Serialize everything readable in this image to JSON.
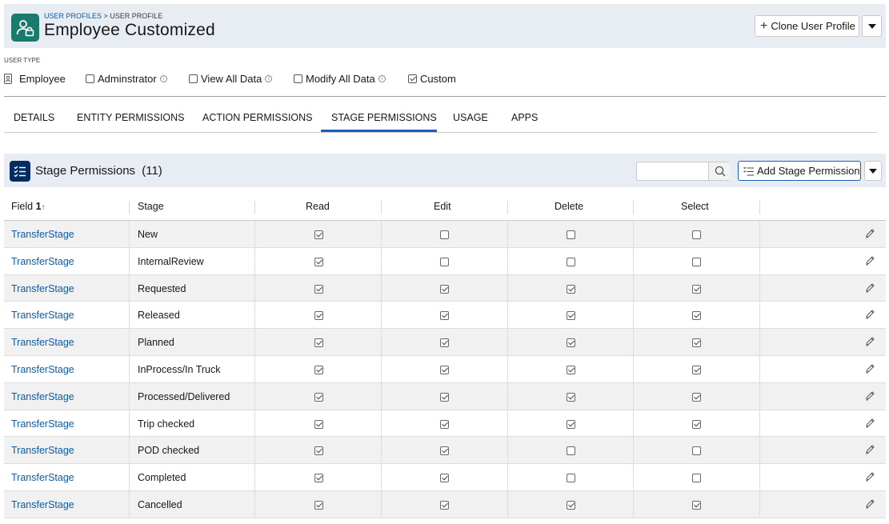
{
  "header": {
    "breadcrumb": {
      "parent": "USER PROFILES",
      "separator": " > ",
      "current": "USER PROFILE"
    },
    "title": "Employee Customized",
    "icon": "user-profile-icon",
    "actions": {
      "clone_label": "Clone User Profile",
      "more_icon": "chevron-down-icon"
    },
    "accent_color": "#1a7a6b"
  },
  "user_type": {
    "label": "USER TYPE",
    "options": [
      {
        "label": "Employee",
        "icon": "employee-badge-icon",
        "checked": null
      },
      {
        "label": "Adminstrator",
        "checked": false,
        "info": true
      },
      {
        "label": "View All Data",
        "checked": false,
        "info": true
      },
      {
        "label": "Modify All Data",
        "checked": false,
        "info": true
      },
      {
        "label": "Custom",
        "checked": true,
        "info": false
      }
    ]
  },
  "tabs": [
    {
      "label": "DETAILS",
      "active": false
    },
    {
      "label": "ENTITY PERMISSIONS",
      "active": false
    },
    {
      "label": "ACTION PERMISSIONS",
      "active": false
    },
    {
      "label": "STAGE PERMISSIONS",
      "active": true
    },
    {
      "label": "USAGE",
      "active": false
    },
    {
      "label": "APPS",
      "active": false
    }
  ],
  "section": {
    "title": "Stage Permissions",
    "count": "(11)",
    "icon": "checklist-icon",
    "search": {
      "placeholder": "",
      "value": ""
    },
    "add_label": "Add Stage Permission"
  },
  "table": {
    "columns": {
      "field": "Field",
      "sort_indicator": "1",
      "stage": "Stage",
      "read": "Read",
      "edit": "Edit",
      "delete": "Delete",
      "select": "Select"
    },
    "rows": [
      {
        "field": "TransferStage",
        "stage": "New",
        "read": true,
        "edit": false,
        "delete": false,
        "select": false
      },
      {
        "field": "TransferStage",
        "stage": "InternalReview",
        "read": true,
        "edit": false,
        "delete": false,
        "select": false
      },
      {
        "field": "TransferStage",
        "stage": "Requested",
        "read": true,
        "edit": true,
        "delete": true,
        "select": true
      },
      {
        "field": "TransferStage",
        "stage": "Released",
        "read": true,
        "edit": true,
        "delete": true,
        "select": true
      },
      {
        "field": "TransferStage",
        "stage": "Planned",
        "read": true,
        "edit": true,
        "delete": true,
        "select": true
      },
      {
        "field": "TransferStage",
        "stage": "InProcess/In Truck",
        "read": true,
        "edit": true,
        "delete": true,
        "select": true
      },
      {
        "field": "TransferStage",
        "stage": "Processed/Delivered",
        "read": true,
        "edit": true,
        "delete": true,
        "select": true
      },
      {
        "field": "TransferStage",
        "stage": "Trip checked",
        "read": true,
        "edit": true,
        "delete": true,
        "select": true
      },
      {
        "field": "TransferStage",
        "stage": "POD checked",
        "read": true,
        "edit": true,
        "delete": false,
        "select": false
      },
      {
        "field": "TransferStage",
        "stage": "Completed",
        "read": true,
        "edit": true,
        "delete": false,
        "select": false
      },
      {
        "field": "TransferStage",
        "stage": "Cancelled",
        "read": true,
        "edit": true,
        "delete": true,
        "select": true
      }
    ],
    "row_action_icon": "pencil-icon",
    "link_color": "#0b5cab"
  }
}
